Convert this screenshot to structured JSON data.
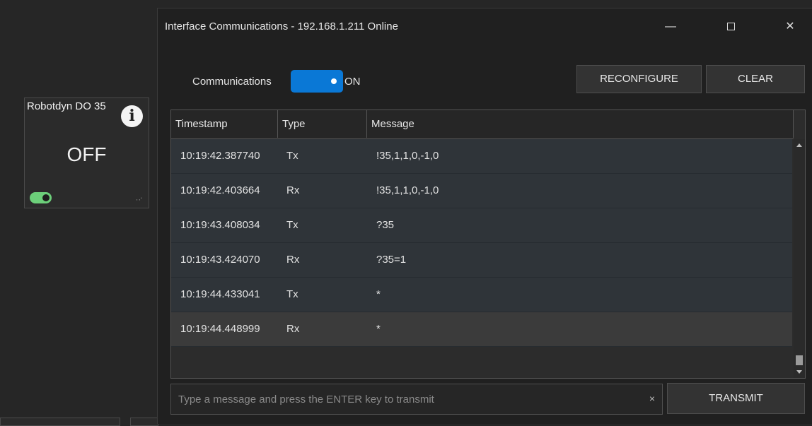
{
  "background_tile": {
    "title": "Robotdyn DO 35",
    "info_icon": "i",
    "state": "OFF",
    "toggle_on": true
  },
  "window": {
    "title": "Interface Communications - 192.168.1.211 Online",
    "controls": {
      "minimize": "—",
      "maximize": "",
      "close": "✕"
    }
  },
  "communications": {
    "label": "Communications",
    "state_label": "ON",
    "on": true
  },
  "buttons": {
    "reconfigure": "RECONFIGURE",
    "clear": "CLEAR",
    "transmit": "TRANSMIT"
  },
  "table": {
    "columns": [
      "Timestamp",
      "Type",
      "Message"
    ],
    "rows": [
      {
        "timestamp": "10:19:42.387740",
        "type": "Tx",
        "message": "!35,1,1,0,-1,0"
      },
      {
        "timestamp": "10:19:42.403664",
        "type": "Rx",
        "message": "!35,1,1,0,-1,0"
      },
      {
        "timestamp": "10:19:43.408034",
        "type": "Tx",
        "message": "?35"
      },
      {
        "timestamp": "10:19:43.424070",
        "type": "Rx",
        "message": "?35=1"
      },
      {
        "timestamp": "10:19:44.433041",
        "type": "Tx",
        "message": "*"
      },
      {
        "timestamp": "10:19:44.448999",
        "type": "Rx",
        "message": "*"
      }
    ],
    "selected_row": 5
  },
  "message_input": {
    "value": "",
    "placeholder": "Type a message and press the ENTER key to transmit",
    "clear_icon": "×"
  },
  "colors": {
    "accent": "#0a78d6",
    "toggle_green": "#6ccf7a"
  }
}
